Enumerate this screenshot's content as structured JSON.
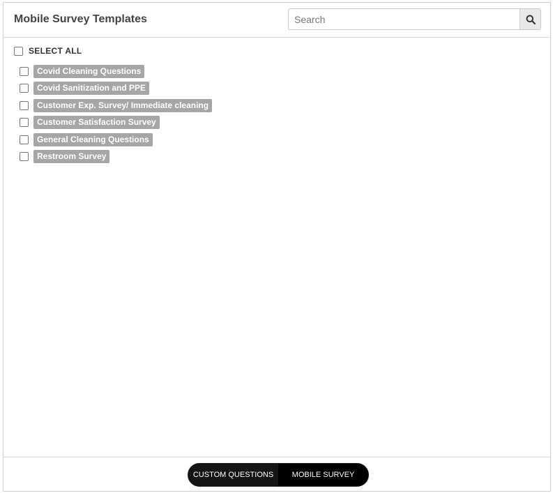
{
  "header": {
    "title": "Mobile Survey Templates",
    "search_placeholder": "Search",
    "search_value": "",
    "search_icon": "search-icon"
  },
  "select_all": {
    "label": "SELECT ALL",
    "checked": false
  },
  "templates": [
    {
      "label": "Covid Cleaning Questions",
      "checked": false
    },
    {
      "label": "Covid Sanitization and PPE",
      "checked": false
    },
    {
      "label": "Customer Exp. Survey/ Immediate cleaning",
      "checked": false
    },
    {
      "label": "Customer Satisfaction Survey",
      "checked": false
    },
    {
      "label": "General Cleaning Questions",
      "checked": false
    },
    {
      "label": "Restroom Survey",
      "checked": false
    }
  ],
  "footer": {
    "tabs": [
      {
        "label": "CUSTOM QUESTIONS"
      },
      {
        "label": "MOBILE SURVEY"
      }
    ]
  },
  "colors": {
    "tag_background": "#a6a6a6",
    "toggle_background": "#000000",
    "title_text": "#444444"
  }
}
